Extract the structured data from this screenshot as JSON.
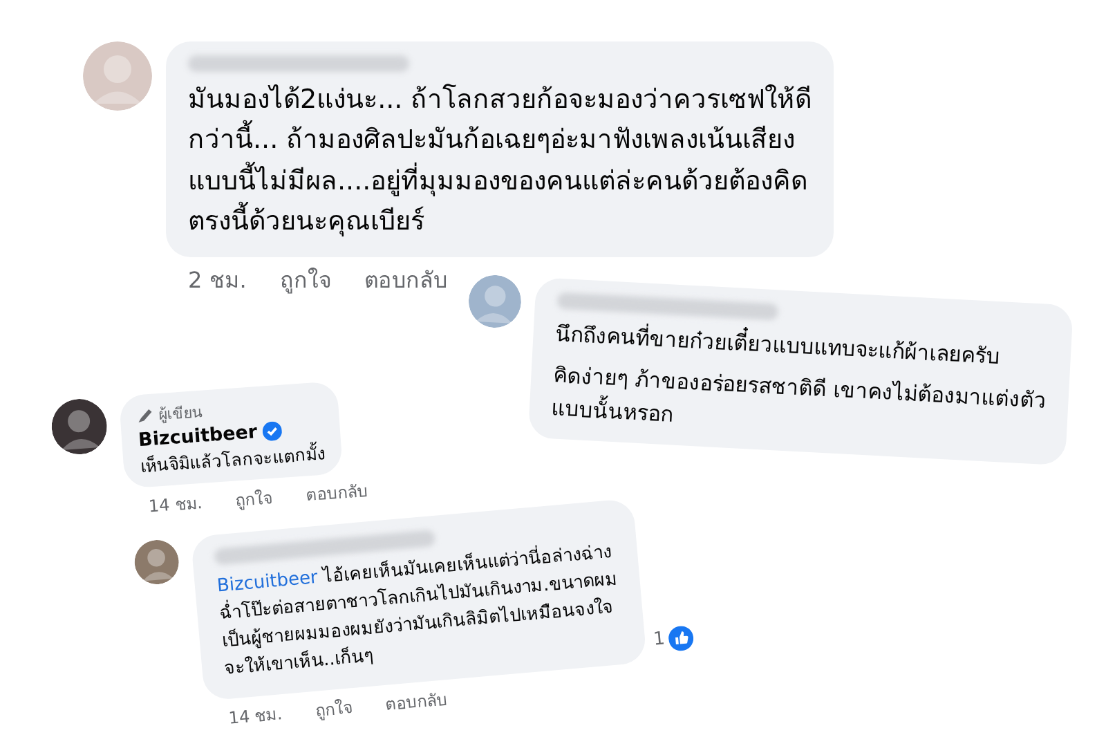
{
  "comments": [
    {
      "kind": "plain",
      "paragraphs": [
        "มันมองได้2แง่นะ... ถ้าโลกสวยก้อจะมองว่าควรเซฟให้ดี\nกว่านี้... ถ้ามองศิลปะมันก้อเฉยๆอ่ะมาฟังเพลงเน้นเสียง\nแบบนี้ไม่มีผล....อยู่ที่มุมมองของคนแต่ล่ะคนด้วยต้องคิด\nตรงนี้ด้วยนะคุณเบียร์"
      ],
      "time": "2 ชม.",
      "like": "ถูกใจ",
      "reply": "ตอบกลับ"
    },
    {
      "kind": "plain",
      "paragraphs": [
        "นึกถึงคนที่ขายก๋วยเตี๋ยวแบบแทบจะแก้ผ้าเลยครับ",
        "คิดง่ายๆ ภ้าของอร่อยรสชาติดี เขาคงไม่ต้องมาแต่งตัว\nแบบนั้นหรอก"
      ]
    },
    {
      "kind": "author",
      "badge": "ผู้เขียน",
      "author": "Bizcuitbeer",
      "verified": true,
      "paragraphs": [
        "เห็นจิมิแล้วโลกจะแตกมั้ง"
      ],
      "time": "14 ชม.",
      "like": "ถูกใจ",
      "reply": "ตอบกลับ"
    },
    {
      "kind": "reply",
      "mention": "Bizcuitbeer",
      "paragraphs": [
        "ไอ้เคยเห็นมันเคยเห็นแต่ว่านี่อล่างฉ่าง\nฉ่ำโป๊ะต่อสายตาชาวโลกเกินไปมันเกินงาม.ขนาดผม\nเป็นผู้ชายผมมองผมยังว่ามันเกินลิมิตไปเหมือนจงใจ\nจะให้เขาเห็น..เก็นๆ"
      ],
      "likes": "1",
      "time": "14 ชม.",
      "like": "ถูกใจ",
      "reply": "ตอบกลับ"
    }
  ]
}
